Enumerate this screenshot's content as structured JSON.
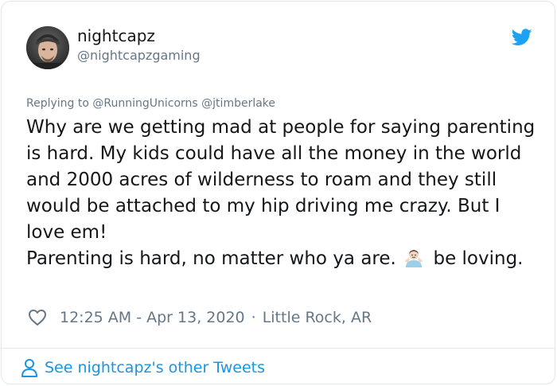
{
  "author": {
    "display_name": "nightcapz",
    "handle": "@nightcapzgaming"
  },
  "reply": {
    "prefix": "Replying to",
    "mentions": [
      "@RunningUnicorns",
      "@jtimberlake"
    ]
  },
  "tweet": {
    "paragraph_1": "Why are we getting mad at people for saying parenting is hard. My kids could have all the money in the world and 2000 acres of wilderness to roam and they still would be attached to my hip driving me crazy. But I love em!",
    "paragraph_2_before_emoji": "Parenting is hard, no matter who ya are.",
    "emoji": "person-shrugging-emoji",
    "paragraph_2_after_emoji": "be loving."
  },
  "meta": {
    "timestamp": "12:25 AM - Apr 13, 2020",
    "separator": "·",
    "location": "Little Rock, AR"
  },
  "footer": {
    "link_label": "See nightcapz's other Tweets"
  },
  "colors": {
    "text_primary": "#14171a",
    "text_secondary": "#657786",
    "link": "#1b95e0",
    "twitter_blue": "#1da1f2",
    "border": "#e1e8ed"
  },
  "icons": {
    "brand": "twitter-bird-icon",
    "like": "heart-icon",
    "profile": "person-icon"
  }
}
